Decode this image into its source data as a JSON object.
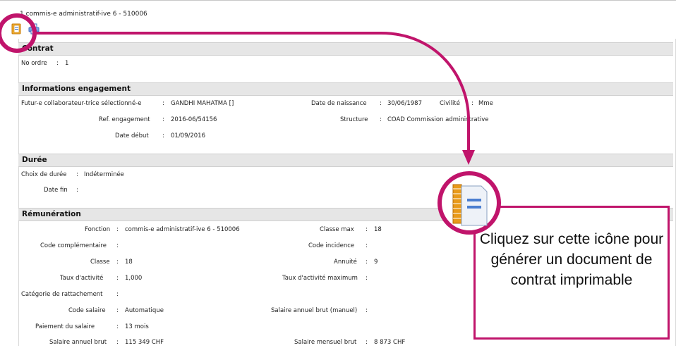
{
  "header": {
    "title": "1 commis-e administratif-ive 6 - 510006"
  },
  "toolbar": {
    "icons": [
      "contract-document-icon",
      "print-icon"
    ]
  },
  "contrat": {
    "heading": "Contrat",
    "no_ordre_label": "No ordre",
    "no_ordre_value": "1"
  },
  "engagement": {
    "heading": "Informations engagement",
    "collaborateur_label": "Futur-e collaborateur-trice sélectionné-e",
    "collaborateur_value": "GANDHI MAHATMA []",
    "naissance_label": "Date de naissance",
    "naissance_value": "30/06/1987",
    "civilite_label": "Civilité",
    "civilite_value": "Mme",
    "ref_label": "Ref. engagement",
    "ref_value": "2016-06/54156",
    "structure_label": "Structure",
    "structure_value": "COAD Commission administrative",
    "debut_label": "Date début",
    "debut_value": "01/09/2016"
  },
  "duree": {
    "heading": "Durée",
    "choix_label": "Choix de durée",
    "choix_value": "Indéterminée",
    "fin_label": "Date fin",
    "fin_value": ""
  },
  "remuneration": {
    "heading": "Rémunération",
    "fonction_label": "Fonction",
    "fonction_value": "commis-e administratif-ive 6 - 510006",
    "classe_max_label": "Classe max",
    "classe_max_value": "18",
    "code_comp_label": "Code complémentaire",
    "code_comp_value": "",
    "code_incidence_label": "Code incidence",
    "code_incidence_value": "",
    "classe_label": "Classe",
    "classe_value": "18",
    "annuite_label": "Annuité",
    "annuite_value": "9",
    "taux_label": "Taux d'activité",
    "taux_value": "1,000",
    "taux_max_label": "Taux d'activité maximum",
    "taux_max_value": "",
    "categorie_label": "Catégorie de rattachement",
    "categorie_value": "",
    "code_salaire_label": "Code salaire",
    "code_salaire_value": "Automatique",
    "salaire_manuel_label": "Salaire annuel brut (manuel)",
    "salaire_manuel_value": "",
    "paiement_label": "Paiement du salaire",
    "paiement_value": "13 mois",
    "salaire_annuel_label": "Salaire annuel brut",
    "salaire_annuel_value": "115 349 CHF",
    "salaire_mensuel_label": "Salaire mensuel brut",
    "salaire_mensuel_value": "8 873 CHF"
  },
  "callout": {
    "text": "Cliquez sur cette icône pour générer un document de contrat imprimable"
  },
  "colors": {
    "accent": "#c0146b",
    "section_bg": "#e6e6e6",
    "icon_orange": "#e89a1a",
    "icon_blue": "#3b6cc4"
  }
}
